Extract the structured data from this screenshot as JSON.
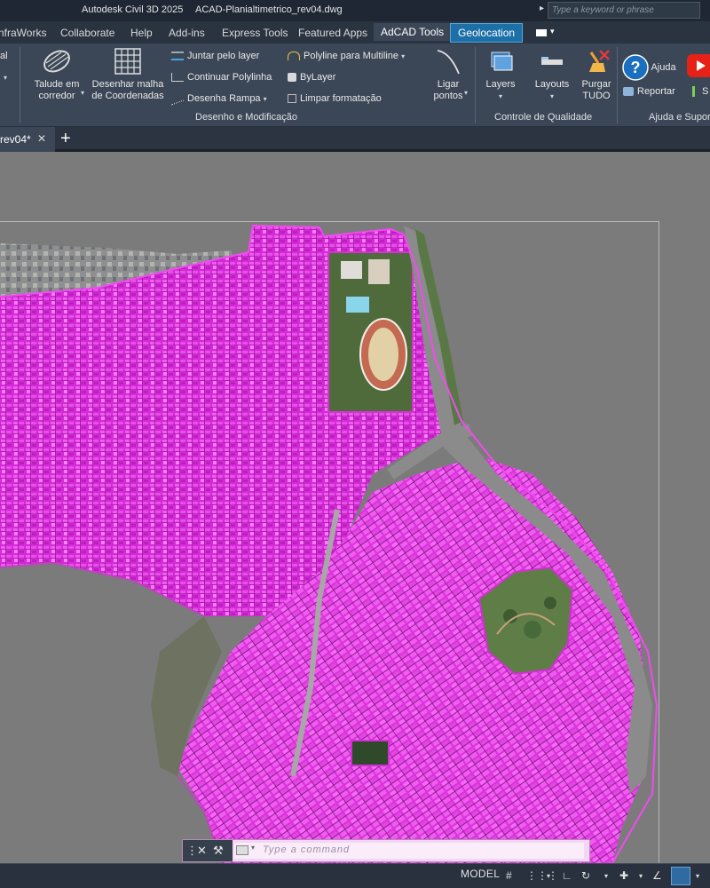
{
  "titlebar": {
    "app_name": "Autodesk Civil 3D 2025",
    "file_name": "ACAD-Planialtimetrico_rev04.dwg",
    "search_placeholder": "Type a keyword or phrase"
  },
  "menu": {
    "tabs": [
      "nfraWorks",
      "Collaborate",
      "Help",
      "Add-ins",
      "Express Tools",
      "Featured Apps",
      "AdCAD Tools",
      "Geolocation"
    ],
    "active_tab": "AdCAD Tools"
  },
  "ribbon": {
    "cut_left_label": "al",
    "big_buttons": {
      "talude": "Talude em\ncorredor",
      "malha": "Desenhar malha\nde Coordenadas",
      "ligar": "Ligar\npontos",
      "layers": "Layers",
      "layouts": "Layouts",
      "purgar": "Purgar\nTUDO",
      "ajuda": "Ajuda",
      "reportar": "Reportar"
    },
    "small_buttons": {
      "juntar": "Juntar pelo layer",
      "continuar": "Continuar Polylinha",
      "rampa": "Desenha Rampa",
      "polyline_multiline": "Polyline para Multiline",
      "bylayer": "ByLayer",
      "limpar": "Limpar formatação",
      "cut_s": "S"
    },
    "groups": {
      "desenho": "Desenho e Modificação",
      "controle": "Controle de Qualidade",
      "ajuda": "Ajuda e Supor"
    }
  },
  "file_tab": {
    "label": "rev04*"
  },
  "command_line": {
    "placeholder": "Type a command"
  },
  "statusbar": {
    "model": "MODEL"
  },
  "colors": {
    "accent_magenta": "#e600e6",
    "geolocation_tab": "#1d6fa8",
    "canvas_bg": "#7b7b7b"
  }
}
